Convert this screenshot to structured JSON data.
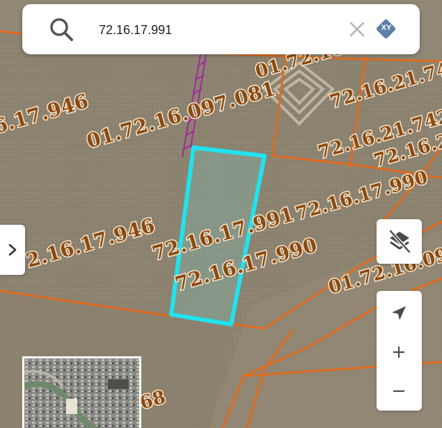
{
  "search": {
    "value": "72.16.17.991",
    "placeholder": "",
    "xy_label": "XY"
  },
  "parcel_labels": [
    {
      "id": "l1",
      "text": "01.72.16.097.081"
    },
    {
      "id": "l2",
      "text": "6.17.946"
    },
    {
      "id": "l3",
      "text": "01.72.16.1"
    },
    {
      "id": "l4",
      "text": "72.16.21.74"
    },
    {
      "id": "l5",
      "text": "72.16.21.742"
    },
    {
      "id": "l6",
      "text": "72.16.2"
    },
    {
      "id": "l7",
      "text": "72.16.17.990"
    },
    {
      "id": "l8",
      "text": "72.16.17.946"
    },
    {
      "id": "l9",
      "text": "72.16.17.991"
    },
    {
      "id": "l10",
      "text": "72.16.17.990"
    },
    {
      "id": "l11",
      "text": "01.72.16.09"
    },
    {
      "id": "l12",
      "text": "68"
    }
  ],
  "selected_parcel": {
    "id": "72.16.17.991",
    "outline_color": "#1fe3ee"
  },
  "colors": {
    "parcel_boundary": "#e06a1e",
    "easement": "#a02a9a",
    "label_text": "#8a4a12",
    "selection": "#1fe3ee"
  },
  "controls": {
    "zoom_in": "+",
    "zoom_out": "−"
  },
  "icons": {
    "search": "search-icon",
    "clear": "close-icon",
    "xy": "xy-diamond-icon",
    "expand": "chevron-right-icon",
    "layers": "layers-off-icon",
    "locate": "location-arrow-icon",
    "minimap": "satellite-minimap"
  }
}
